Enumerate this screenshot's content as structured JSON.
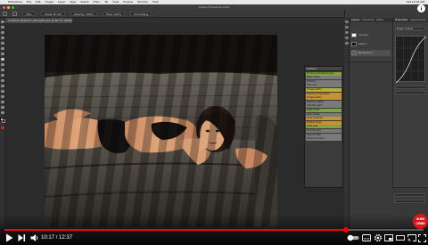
{
  "menubar": {
    "items": [
      "Photoshop",
      "File",
      "Edit",
      "Image",
      "Layer",
      "Type",
      "Select",
      "Filter",
      "3D",
      "View",
      "Plugins",
      "Window",
      "Help"
    ],
    "clock": "Sat 10:16 AM"
  },
  "window": {
    "title": "Adobe Photoshop 2022"
  },
  "optionsbar": {
    "items": [
      "Size:",
      "Mode: Brush",
      "Opacity: 100%",
      "Flow: 100%",
      "Smoothing"
    ]
  },
  "document": {
    "tab_label": "Untitled-1@photo-edit-light.psd @ 66.7% (RGB/8)"
  },
  "actions_menu": {
    "header": "Actions",
    "items": [
      {
        "label": "Enhance Contrast & Color",
        "color": "#7fa33d"
      },
      {
        "label": "Warm Tones",
        "color": "#7a7a7a"
      },
      {
        "label": "Soft Skin",
        "color": "#7a7a7a"
      },
      {
        "label": "Film Look",
        "color": "#7a7a7a"
      },
      {
        "label": "Dodge & Burn",
        "color": "#b8b234"
      },
      {
        "label": "Frequency Separation",
        "color": "#c79231"
      },
      {
        "label": "Dodge & Burn",
        "color": "#c79231"
      },
      {
        "label": "Sharpen Details",
        "color": "#7a7a7a"
      },
      {
        "label": "Vignette Light",
        "color": "#7a7a7a"
      },
      {
        "label": "Matte Finish",
        "color": "#7fa33d"
      },
      {
        "label": "Color Grade",
        "color": "#7a7a7a"
      },
      {
        "label": "Clean Shadows",
        "color": "#c79231"
      },
      {
        "label": "Brighten Eyes",
        "color": "#c79231"
      },
      {
        "label": "Light Leak",
        "color": "#7fa33d"
      },
      {
        "label": "Final Sharpen",
        "color": "#7a7a7a"
      },
      {
        "label": "Save for Web",
        "color": "#7a7a7a"
      },
      {
        "label": "Flatten & Export",
        "color": "#7a7a7a"
      }
    ]
  },
  "layers_panel": {
    "tabs": [
      "Layers",
      "Channels",
      "Paths"
    ],
    "rows": [
      {
        "name": "Curves 1"
      },
      {
        "name": "Layer 1"
      },
      {
        "name": "Background"
      }
    ]
  },
  "properties_panel": {
    "tabs": [
      "Properties",
      "Adjustments"
    ],
    "preset_label": "Preset: Custom"
  },
  "player": {
    "time_current": "10:17",
    "time_total": "12:37",
    "time_separator": "/",
    "progress": 0.814,
    "accent": "#ff0000",
    "subscribe_line1": "SUBS",
    "subscribe_line2": "CRIBE"
  }
}
